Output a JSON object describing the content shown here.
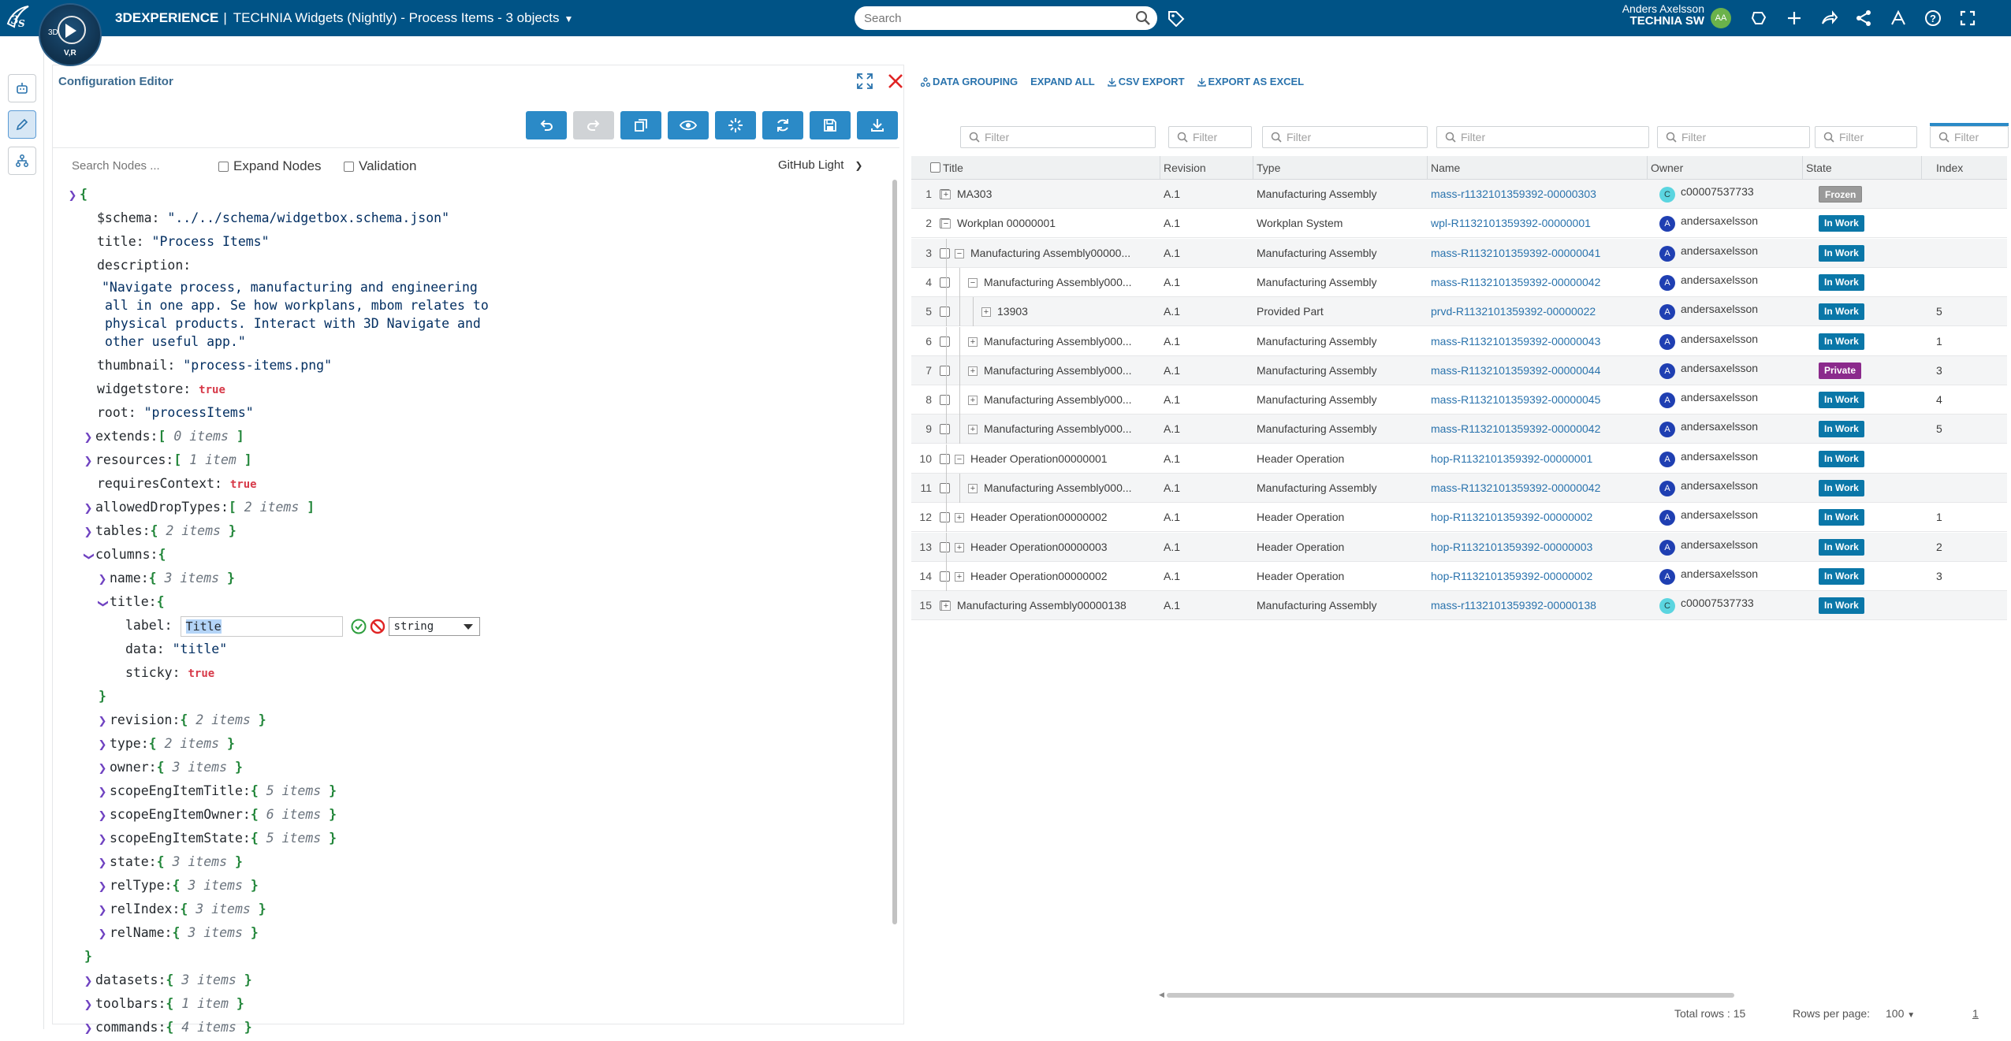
{
  "topbar": {
    "brand_bold": "3DEXPERIENCE",
    "brand_sep": "|",
    "app_title": "TECHNIA Widgets (Nightly) - Process Items - 3 objects",
    "compass_label": "V,R",
    "compass_3d": "3D",
    "search_placeholder": "Search",
    "user_name": "Anders Axelsson",
    "company": "TECHNIA SW",
    "avatar_initials": "AA"
  },
  "config_editor": {
    "title": "Configuration Editor",
    "search_placeholder": "Search Nodes ...",
    "expand_nodes_label": "Expand Nodes",
    "validation_label": "Validation",
    "theme": "GitHub Light"
  },
  "code": {
    "open_brace": "{",
    "close_brace": "}",
    "schema_key": "$schema:",
    "schema_val": "\"../../schema/widgetbox.schema.json\"",
    "title_key": "title:",
    "title_val": "\"Process Items\"",
    "desc_key": "description:",
    "desc_1": "\"Navigate process, manufacturing and engineering",
    "desc_2": "all in one app. Se how workplans, mbom relates to",
    "desc_3": "physical products. Interact with 3D Navigate and",
    "desc_4": "other useful app.\"",
    "thumb_key": "thumbnail:",
    "thumb_val": "\"process-items.png\"",
    "widgetstore_key": "widgetstore:",
    "true_val": "true",
    "root_key": "root:",
    "root_val": "\"processItems\"",
    "extends_key": "extends:",
    "extends_cnt": "0 items",
    "resources_key": "resources:",
    "resources_cnt": "1 item",
    "reqctx_key": "requiresContext:",
    "adt_key": "allowedDropTypes:",
    "adt_cnt": "2 items",
    "tables_key": "tables:",
    "tables_cnt": "2 items",
    "columns_key": "columns:",
    "name_key": "name:",
    "name_cnt": "3 items",
    "titleobj_key": "title:",
    "label_key": "label:",
    "label_val": "Title",
    "type_select": "string",
    "data_key": "data:",
    "data_val": "\"title\"",
    "sticky_key": "sticky:",
    "revision_key": "revision:",
    "revision_cnt": "2 items",
    "type_key": "type:",
    "type_cnt": "2 items",
    "owner_key": "owner:",
    "owner_cnt": "3 items",
    "seit_key": "scopeEngItemTitle:",
    "seit_cnt": "5 items",
    "seio_key": "scopeEngItemOwner:",
    "seio_cnt": "6 items",
    "seis_key": "scopeEngItemState:",
    "seis_cnt": "5 items",
    "state_key": "state:",
    "state_cnt": "3 items",
    "reltype_key": "relType:",
    "reltype_cnt": "3 items",
    "relindex_key": "relIndex:",
    "relindex_cnt": "3 items",
    "relname_key": "relName:",
    "relname_cnt": "3 items",
    "datasets_key": "datasets:",
    "datasets_cnt": "3 items",
    "toolbars_key": "toolbars:",
    "toolbars_cnt": "1 item",
    "commands_key": "commands:",
    "commands_cnt": "4 items"
  },
  "grid": {
    "actions": {
      "data_grouping": "DATA GROUPING",
      "expand_all": "EXPAND ALL",
      "csv_export": "CSV EXPORT",
      "excel_export": "EXPORT AS EXCEL"
    },
    "filter_placeholder": "Filter",
    "columns": {
      "title": "Title",
      "revision": "Revision",
      "type": "Type",
      "name": "Name",
      "owner": "Owner",
      "state": "State",
      "index": "Index"
    },
    "rows": [
      {
        "num": "1",
        "depth": 0,
        "toggle": "+",
        "title": "MA303",
        "revision": "A.1",
        "type": "Manufacturing Assembly",
        "name": "mass-r1132101359392-00000303",
        "owner_initial": "C",
        "owner": "c00007537733",
        "state": "Frozen",
        "index": ""
      },
      {
        "num": "2",
        "depth": 0,
        "toggle": "−",
        "title": "Workplan 00000001",
        "revision": "A.1",
        "type": "Workplan System",
        "name": "wpl-R1132101359392-00000001",
        "owner_initial": "A",
        "owner": "andersaxelsson",
        "state": "In Work",
        "index": ""
      },
      {
        "num": "3",
        "depth": 1,
        "toggle": "−",
        "title": "Manufacturing Assembly00000...",
        "revision": "A.1",
        "type": "Manufacturing Assembly",
        "name": "mass-R1132101359392-00000041",
        "owner_initial": "A",
        "owner": "andersaxelsson",
        "state": "In Work",
        "index": ""
      },
      {
        "num": "4",
        "depth": 2,
        "toggle": "−",
        "title": "Manufacturing Assembly000...",
        "revision": "A.1",
        "type": "Manufacturing Assembly",
        "name": "mass-R1132101359392-00000042",
        "owner_initial": "A",
        "owner": "andersaxelsson",
        "state": "In Work",
        "index": ""
      },
      {
        "num": "5",
        "depth": 3,
        "toggle": "+",
        "title": "13903",
        "revision": "A.1",
        "type": "Provided Part",
        "name": "prvd-R1132101359392-00000022",
        "owner_initial": "A",
        "owner": "andersaxelsson",
        "state": "In Work",
        "index": "5"
      },
      {
        "num": "6",
        "depth": 2,
        "toggle": "+",
        "title": "Manufacturing Assembly000...",
        "revision": "A.1",
        "type": "Manufacturing Assembly",
        "name": "mass-R1132101359392-00000043",
        "owner_initial": "A",
        "owner": "andersaxelsson",
        "state": "In Work",
        "index": "1"
      },
      {
        "num": "7",
        "depth": 2,
        "toggle": "+",
        "title": "Manufacturing Assembly000...",
        "revision": "A.1",
        "type": "Manufacturing Assembly",
        "name": "mass-R1132101359392-00000044",
        "owner_initial": "A",
        "owner": "andersaxelsson",
        "state": "Private",
        "index": "3"
      },
      {
        "num": "8",
        "depth": 2,
        "toggle": "+",
        "title": "Manufacturing Assembly000...",
        "revision": "A.1",
        "type": "Manufacturing Assembly",
        "name": "mass-R1132101359392-00000045",
        "owner_initial": "A",
        "owner": "andersaxelsson",
        "state": "In Work",
        "index": "4"
      },
      {
        "num": "9",
        "depth": 2,
        "toggle": "+",
        "title": "Manufacturing Assembly000...",
        "revision": "A.1",
        "type": "Manufacturing Assembly",
        "name": "mass-R1132101359392-00000042",
        "owner_initial": "A",
        "owner": "andersaxelsson",
        "state": "In Work",
        "index": "5"
      },
      {
        "num": "10",
        "depth": 1,
        "toggle": "−",
        "title": "Header Operation00000001",
        "revision": "A.1",
        "type": "Header Operation",
        "name": "hop-R1132101359392-00000001",
        "owner_initial": "A",
        "owner": "andersaxelsson",
        "state": "In Work",
        "index": ""
      },
      {
        "num": "11",
        "depth": 2,
        "toggle": "+",
        "title": "Manufacturing Assembly000...",
        "revision": "A.1",
        "type": "Manufacturing Assembly",
        "name": "mass-R1132101359392-00000042",
        "owner_initial": "A",
        "owner": "andersaxelsson",
        "state": "In Work",
        "index": ""
      },
      {
        "num": "12",
        "depth": 1,
        "toggle": "+",
        "title": "Header Operation00000002",
        "revision": "A.1",
        "type": "Header Operation",
        "name": "hop-R1132101359392-00000002",
        "owner_initial": "A",
        "owner": "andersaxelsson",
        "state": "In Work",
        "index": "1"
      },
      {
        "num": "13",
        "depth": 1,
        "toggle": "+",
        "title": "Header Operation00000003",
        "revision": "A.1",
        "type": "Header Operation",
        "name": "hop-R1132101359392-00000003",
        "owner_initial": "A",
        "owner": "andersaxelsson",
        "state": "In Work",
        "index": "2"
      },
      {
        "num": "14",
        "depth": 1,
        "toggle": "+",
        "title": "Header Operation00000002",
        "revision": "A.1",
        "type": "Header Operation",
        "name": "hop-R1132101359392-00000002",
        "owner_initial": "A",
        "owner": "andersaxelsson",
        "state": "In Work",
        "index": "3"
      },
      {
        "num": "15",
        "depth": 0,
        "toggle": "+",
        "title": "Manufacturing Assembly00000138",
        "revision": "A.1",
        "type": "Manufacturing Assembly",
        "name": "mass-r1132101359392-00000138",
        "owner_initial": "C",
        "owner": "c00007537733",
        "state": "In Work",
        "index": ""
      }
    ],
    "footer": {
      "total_rows": "Total rows : 15",
      "rows_per_page_label": "Rows per page:",
      "rows_per_page_value": "100",
      "page": "1"
    }
  }
}
